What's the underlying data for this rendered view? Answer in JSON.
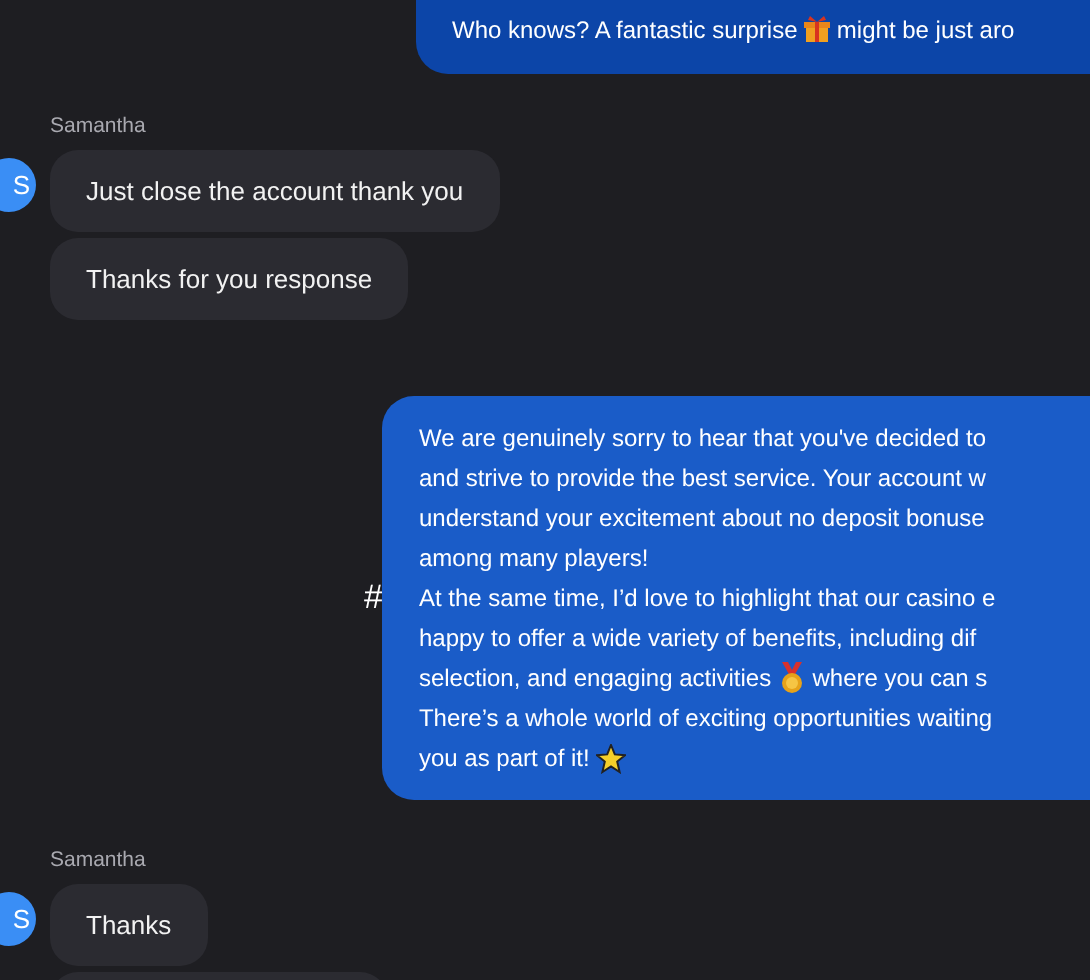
{
  "messages": [
    {
      "kind": "outgoing",
      "lines": [
        [
          {
            "kind": "text",
            "text": "Who knows? A fantastic surprise "
          },
          {
            "kind": "gift"
          },
          {
            "kind": "text",
            "text": " might be just aro"
          }
        ]
      ]
    },
    {
      "kind": "incoming",
      "sender": "Samantha",
      "avatar": "S",
      "bubbles": [
        "Just close the account thank you",
        "Thanks for you response"
      ]
    },
    {
      "kind": "outgoing",
      "marker": "#",
      "lines": [
        [
          {
            "kind": "text",
            "text": "We are genuinely sorry to hear that you've decided to"
          }
        ],
        [
          {
            "kind": "text",
            "text": "and strive to provide the best service. Your account w"
          }
        ],
        [
          {
            "kind": "text",
            "text": "understand your excitement about no deposit bonuse"
          }
        ],
        [
          {
            "kind": "text",
            "text": "among many players!"
          }
        ],
        [
          {
            "kind": "text",
            "text": "At the same time, I’d love to highlight that our casino e"
          }
        ],
        [
          {
            "kind": "text",
            "text": "happy to offer a wide variety of benefits, including dif"
          }
        ],
        [
          {
            "kind": "text",
            "text": "selection, and engaging activities "
          },
          {
            "kind": "medal"
          },
          {
            "kind": "text",
            "text": " where you can s"
          }
        ],
        [
          {
            "kind": "text",
            "text": "There’s a whole world of exciting opportunities waiting"
          }
        ],
        [
          {
            "kind": "text",
            "text": "you as part of it! "
          },
          {
            "kind": "star"
          }
        ]
      ]
    },
    {
      "kind": "incoming",
      "sender": "Samantha",
      "avatar": "S",
      "bubbles": [
        "Thanks"
      ],
      "cut_bubble_below": true
    }
  ]
}
